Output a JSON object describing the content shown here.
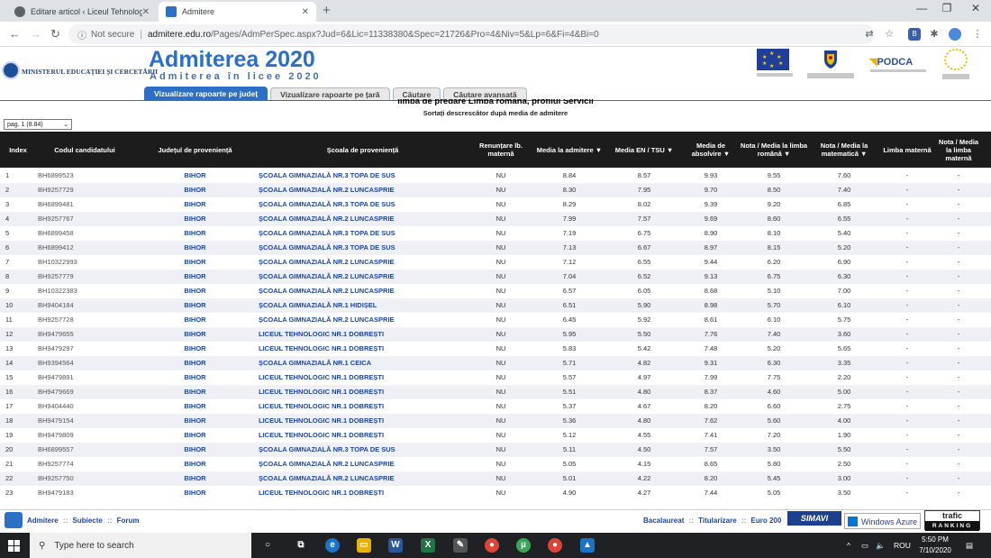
{
  "browser": {
    "tabs": [
      {
        "label": "Editare articol ‹ Liceul Tehnologic",
        "active": false
      },
      {
        "label": "Admitere",
        "active": true
      }
    ],
    "new_tab": "+",
    "url_not_secure": "Not secure",
    "url_host": "admitere.edu.ro",
    "url_path": "/Pages/AdmPerSpec.aspx?Jud=6&Lic=11338380&Spec=21726&Pro=4&Niv=5&Lp=6&Fi=4&Bi=0"
  },
  "site": {
    "ministry": "MINISTERUL EDUCAȚIEI ȘI CERCETĂRII",
    "title": "Admiterea 2020",
    "subtitle": "Admiterea în licee 2020",
    "partner_podca": "PODCA",
    "tabs": [
      "Vizualizare rapoarte pe județ",
      "Vizualizare rapoarte pe țară",
      "Căutare",
      "Căutare avansată"
    ]
  },
  "page": {
    "heading": "limba de predare Limba română, profilul Servicii",
    "sort_note": "Sortați descrescător după media de admitere",
    "pager_value": "pag. 1 (8.84)"
  },
  "table": {
    "headers": {
      "index": "Index",
      "code": "Codul candidatului",
      "county": "Județul de proveniență",
      "school": "Școala de proveniență",
      "renunt": "Renunțare lb. maternă",
      "media_adm": "Media la admitere ▼",
      "media_en": "Media EN / TSU ▼",
      "media_abs": "Media de absolvire ▼",
      "nota_ro": "Nota / Media la limba română ▼",
      "nota_mat": "Nota / Media la matematică ▼",
      "limba_mat": "Limba maternă",
      "nota_lm": "Nota / Media la limba maternă"
    },
    "rows": [
      [
        "1",
        "BH6899523",
        "BIHOR",
        "ȘCOALA GIMNAZIALĂ NR.3 TOPA DE SUS",
        "NU",
        "8.84",
        "8.57",
        "9.93",
        "9.55",
        "7.60",
        "-",
        "-"
      ],
      [
        "2",
        "BH9257729",
        "BIHOR",
        "ȘCOALA GIMNAZIALĂ NR.2 LUNCASPRIE",
        "NU",
        "8.30",
        "7.95",
        "9.70",
        "8.50",
        "7.40",
        "-",
        "-"
      ],
      [
        "3",
        "BH6899481",
        "BIHOR",
        "ȘCOALA GIMNAZIALĂ NR.3 TOPA DE SUS",
        "NU",
        "8.29",
        "8.02",
        "9.39",
        "9.20",
        "6.85",
        "-",
        "-"
      ],
      [
        "4",
        "BH9257767",
        "BIHOR",
        "ȘCOALA GIMNAZIALĂ NR.2 LUNCASPRIE",
        "NU",
        "7.99",
        "7.57",
        "9.69",
        "8.60",
        "6.55",
        "-",
        "-"
      ],
      [
        "5",
        "BH6899458",
        "BIHOR",
        "ȘCOALA GIMNAZIALĂ NR.3 TOPA DE SUS",
        "NU",
        "7.19",
        "6.75",
        "8.90",
        "8.10",
        "5.40",
        "-",
        "-"
      ],
      [
        "6",
        "BH6899412",
        "BIHOR",
        "ȘCOALA GIMNAZIALĂ NR.3 TOPA DE SUS",
        "NU",
        "7.13",
        "6.67",
        "8.97",
        "8.15",
        "5.20",
        "-",
        "-"
      ],
      [
        "7",
        "BH10322993",
        "BIHOR",
        "ȘCOALA GIMNAZIALĂ NR.2 LUNCASPRIE",
        "NU",
        "7.12",
        "6.55",
        "9.44",
        "6.20",
        "6.90",
        "-",
        "-"
      ],
      [
        "8",
        "BH9257779",
        "BIHOR",
        "ȘCOALA GIMNAZIALĂ NR.2 LUNCASPRIE",
        "NU",
        "7.04",
        "6.52",
        "9.13",
        "6.75",
        "6.30",
        "-",
        "-"
      ],
      [
        "9",
        "BH10322383",
        "BIHOR",
        "ȘCOALA GIMNAZIALĂ NR.2 LUNCASPRIE",
        "NU",
        "6.57",
        "6.05",
        "8.68",
        "5.10",
        "7.00",
        "-",
        "-"
      ],
      [
        "10",
        "BH9404184",
        "BIHOR",
        "ȘCOALA GIMNAZIALĂ NR.1 HIDIȘEL",
        "NU",
        "6.51",
        "5.90",
        "8.98",
        "5.70",
        "6.10",
        "-",
        "-"
      ],
      [
        "11",
        "BH9257728",
        "BIHOR",
        "ȘCOALA GIMNAZIALĂ NR.2 LUNCASPRIE",
        "NU",
        "6.45",
        "5.92",
        "8.61",
        "6.10",
        "5.75",
        "-",
        "-"
      ],
      [
        "12",
        "BH9479655",
        "BIHOR",
        "LICEUL TEHNOLOGIC NR.1 DOBREȘTI",
        "NU",
        "5.95",
        "5.50",
        "7.76",
        "7.40",
        "3.60",
        "-",
        "-"
      ],
      [
        "13",
        "BH9479297",
        "BIHOR",
        "LICEUL TEHNOLOGIC NR.1 DOBREȘTI",
        "NU",
        "5.83",
        "5.42",
        "7.48",
        "5.20",
        "5.65",
        "-",
        "-"
      ],
      [
        "14",
        "BH9394564",
        "BIHOR",
        "ȘCOALA GIMNAZIALĂ NR.1 CEICA",
        "NU",
        "5.71",
        "4.82",
        "9.31",
        "6.30",
        "3.35",
        "-",
        "-"
      ],
      [
        "15",
        "BH9479891",
        "BIHOR",
        "LICEUL TEHNOLOGIC NR.1 DOBREȘTI",
        "NU",
        "5.57",
        "4.97",
        "7.99",
        "7.75",
        "2.20",
        "-",
        "-"
      ],
      [
        "16",
        "BH9479669",
        "BIHOR",
        "LICEUL TEHNOLOGIC NR.1 DOBREȘTI",
        "NU",
        "5.51",
        "4.80",
        "8.37",
        "4.60",
        "5.00",
        "-",
        "-"
      ],
      [
        "17",
        "BH9404440",
        "BIHOR",
        "LICEUL TEHNOLOGIC NR.1 DOBREȘTI",
        "NU",
        "5.37",
        "4.67",
        "8.20",
        "6.60",
        "2.75",
        "-",
        "-"
      ],
      [
        "18",
        "BH9479154",
        "BIHOR",
        "LICEUL TEHNOLOGIC NR.1 DOBREȘTI",
        "NU",
        "5.36",
        "4.80",
        "7.62",
        "5.60",
        "4.00",
        "-",
        "-"
      ],
      [
        "19",
        "BH9479809",
        "BIHOR",
        "LICEUL TEHNOLOGIC NR.1 DOBREȘTI",
        "NU",
        "5.12",
        "4.55",
        "7.41",
        "7.20",
        "1.90",
        "-",
        "-"
      ],
      [
        "20",
        "BH6899557",
        "BIHOR",
        "ȘCOALA GIMNAZIALĂ NR.3 TOPA DE SUS",
        "NU",
        "5.11",
        "4.50",
        "7.57",
        "3.50",
        "5.50",
        "-",
        "-"
      ],
      [
        "21",
        "BH9257774",
        "BIHOR",
        "ȘCOALA GIMNAZIALĂ NR.2 LUNCASPRIE",
        "NU",
        "5.05",
        "4.15",
        "8.65",
        "5.80",
        "2.50",
        "-",
        "-"
      ],
      [
        "22",
        "BH9257750",
        "BIHOR",
        "ȘCOALA GIMNAZIALĂ NR.2 LUNCASPRIE",
        "NU",
        "5.01",
        "4.22",
        "8.20",
        "5.45",
        "3.00",
        "-",
        "-"
      ],
      [
        "23",
        "BH9479183",
        "BIHOR",
        "LICEUL TEHNOLOGIC NR.1 DOBREȘTI",
        "NU",
        "4.90",
        "4.27",
        "7.44",
        "5.05",
        "3.50",
        "-",
        "-"
      ]
    ]
  },
  "footer": {
    "left_links": [
      "Admitere",
      "Subiecte",
      "Forum"
    ],
    "right_links": [
      "Bacalaureat",
      "Titularizare",
      "Euro 200"
    ],
    "separator": "::",
    "simavi": "SIMAVI",
    "azure": "Windows Azure",
    "trafic_top": "trafic",
    "trafic_bottom": "RANKING"
  },
  "taskbar": {
    "search_placeholder": "Type here to search",
    "lang": "ROU",
    "time": "5:50 PM",
    "date": "7/10/2020"
  },
  "colors": {
    "header_bg": "#1c1c1c",
    "link_blue": "#1e46a8",
    "tab_blue": "#2d6fc4",
    "alt_row": "#eef0f5"
  }
}
